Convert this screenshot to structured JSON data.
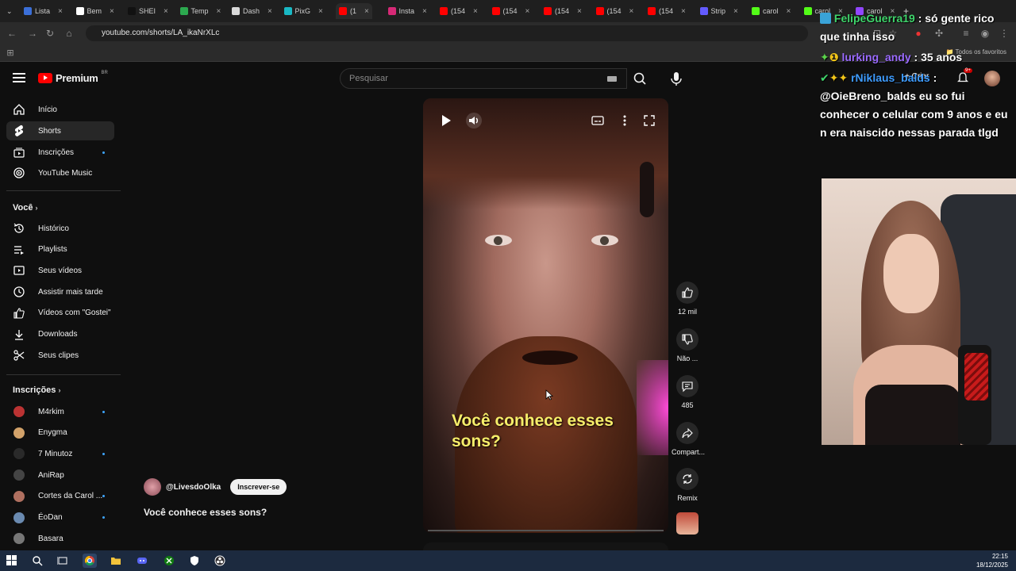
{
  "browser": {
    "tabs": [
      {
        "label": "Lista",
        "color": "#3b6fd8"
      },
      {
        "label": "Bem",
        "color": "#ffffff"
      },
      {
        "label": "SHEI",
        "color": "#111111"
      },
      {
        "label": "Temp",
        "color": "#2ca94f"
      },
      {
        "label": "Dash",
        "color": "#d9d9d9"
      },
      {
        "label": "PixG",
        "color": "#19b8c4"
      },
      {
        "label": "(1",
        "color": "#ff0000"
      },
      {
        "label": "Insta",
        "color": "#d62976"
      },
      {
        "label": "(154",
        "color": "#ff0000"
      },
      {
        "label": "(154",
        "color": "#ff0000"
      },
      {
        "label": "(154",
        "color": "#ff0000"
      },
      {
        "label": "(154",
        "color": "#ff0000"
      },
      {
        "label": "(154",
        "color": "#ff0000"
      },
      {
        "label": "Strip",
        "color": "#635bff"
      },
      {
        "label": "carol",
        "color": "#53fc18"
      },
      {
        "label": "carol",
        "color": "#53fc18"
      },
      {
        "label": "carol",
        "color": "#9146ff"
      }
    ],
    "url": "youtube.com/shorts/LA_ikaNrXLc",
    "bookmarks_all": "Todos os favoritos"
  },
  "header": {
    "logo_text": "Premium",
    "logo_country": "BR",
    "search_placeholder": "Pesquisar",
    "create_label": "Criar",
    "notif_count": "9+"
  },
  "sidebar": {
    "main": [
      {
        "label": "Início",
        "icon": "home-icon"
      },
      {
        "label": "Shorts",
        "icon": "shorts-icon"
      },
      {
        "label": "Inscrições",
        "icon": "subscriptions-icon"
      },
      {
        "label": "YouTube Music",
        "icon": "music-icon"
      }
    ],
    "you_heading": "Você",
    "you": [
      {
        "label": "Histórico",
        "icon": "history-icon"
      },
      {
        "label": "Playlists",
        "icon": "playlists-icon"
      },
      {
        "label": "Seus vídeos",
        "icon": "your-videos-icon"
      },
      {
        "label": "Assistir mais tarde",
        "icon": "watch-later-icon"
      },
      {
        "label": "Vídeos com \"Gostei\"",
        "icon": "liked-icon"
      },
      {
        "label": "Downloads",
        "icon": "download-icon"
      },
      {
        "label": "Seus clipes",
        "icon": "scissors-icon"
      }
    ],
    "subs_heading": "Inscrições",
    "subs": [
      {
        "label": "M4rkim",
        "color": "#b33"
      },
      {
        "label": "Enygma",
        "color": "#d2a26a"
      },
      {
        "label": "7 Minutoz",
        "color": "#2a2a2a"
      },
      {
        "label": "AniRap",
        "color": "#444"
      },
      {
        "label": "Cortes da Carol ...",
        "color": "#b07060"
      },
      {
        "label": "ÉoDan",
        "color": "#6a8ab0"
      },
      {
        "label": "Basara",
        "color": "#777"
      }
    ]
  },
  "video": {
    "caption": "Você conhece esses sons?",
    "channel": "@LivesdoOlka",
    "subscribe": "Inscrever-se",
    "title": "Você conhece esses sons?"
  },
  "actions": {
    "like": "12 mil",
    "dislike": "Não ...",
    "comments": "485",
    "share": "Compart...",
    "remix": "Remix"
  },
  "chat": {
    "lines": [
      {
        "user": "FelipeGuerra19",
        "user_color": "#3fd46b",
        "text": " : só gente rico que tinha isso"
      },
      {
        "user": "lurking_andy",
        "user_color": "#9b6bff",
        "text": " : 35 anos"
      },
      {
        "user": "rNiklaus_balds",
        "user_color": "#3e9cff",
        "text": " : @OieBreno_balds eu so fui conhecer o celular com 9 anos e eu n era naiscido nessas parada tlgd"
      }
    ]
  },
  "taskbar": {
    "time": "22:15",
    "date": "18/12/2025"
  }
}
